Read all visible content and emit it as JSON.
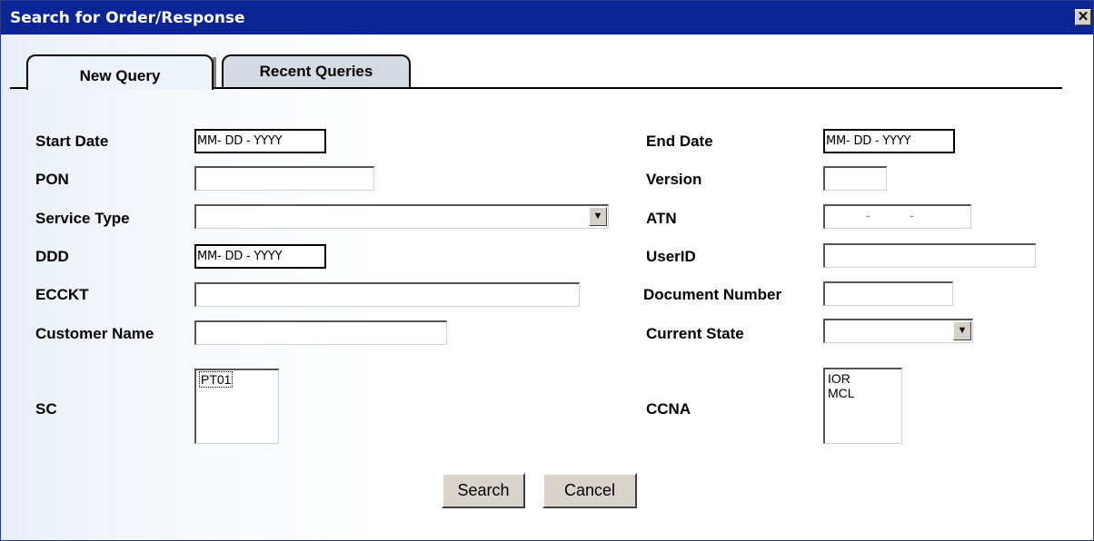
{
  "window": {
    "title": "Search for Order/Response",
    "close_glyph": "✕"
  },
  "tabs": [
    {
      "label": "New Query",
      "active": true
    },
    {
      "label": "Recent Queries",
      "active": false
    }
  ],
  "fields": {
    "start_date": {
      "label": "Start Date",
      "value": "MM- DD - YYYY"
    },
    "end_date": {
      "label": "End Date",
      "value": "MM- DD - YYYY"
    },
    "pon": {
      "label": "PON",
      "value": ""
    },
    "version": {
      "label": "Version",
      "value": ""
    },
    "service_type": {
      "label": "Service Type",
      "selected": ""
    },
    "atn": {
      "label": "ATN",
      "dash": "-"
    },
    "ddd": {
      "label": "DDD",
      "value": "MM- DD - YYYY"
    },
    "userid": {
      "label": "UserID",
      "value": ""
    },
    "ecckt": {
      "label": "ECCKT",
      "value": ""
    },
    "document_number": {
      "label": "Document Number",
      "value": ""
    },
    "customer_name": {
      "label": "Customer Name",
      "value": ""
    },
    "current_state": {
      "label": "Current State",
      "selected": ""
    },
    "sc": {
      "label": "SC",
      "options": [
        "PT01"
      ]
    },
    "ccna": {
      "label": "CCNA",
      "options": [
        "IOR",
        "MCL"
      ]
    }
  },
  "buttons": {
    "search": "Search",
    "cancel": "Cancel"
  },
  "icons": {
    "close": "close-icon",
    "dropdown": "chevron-down-icon"
  }
}
